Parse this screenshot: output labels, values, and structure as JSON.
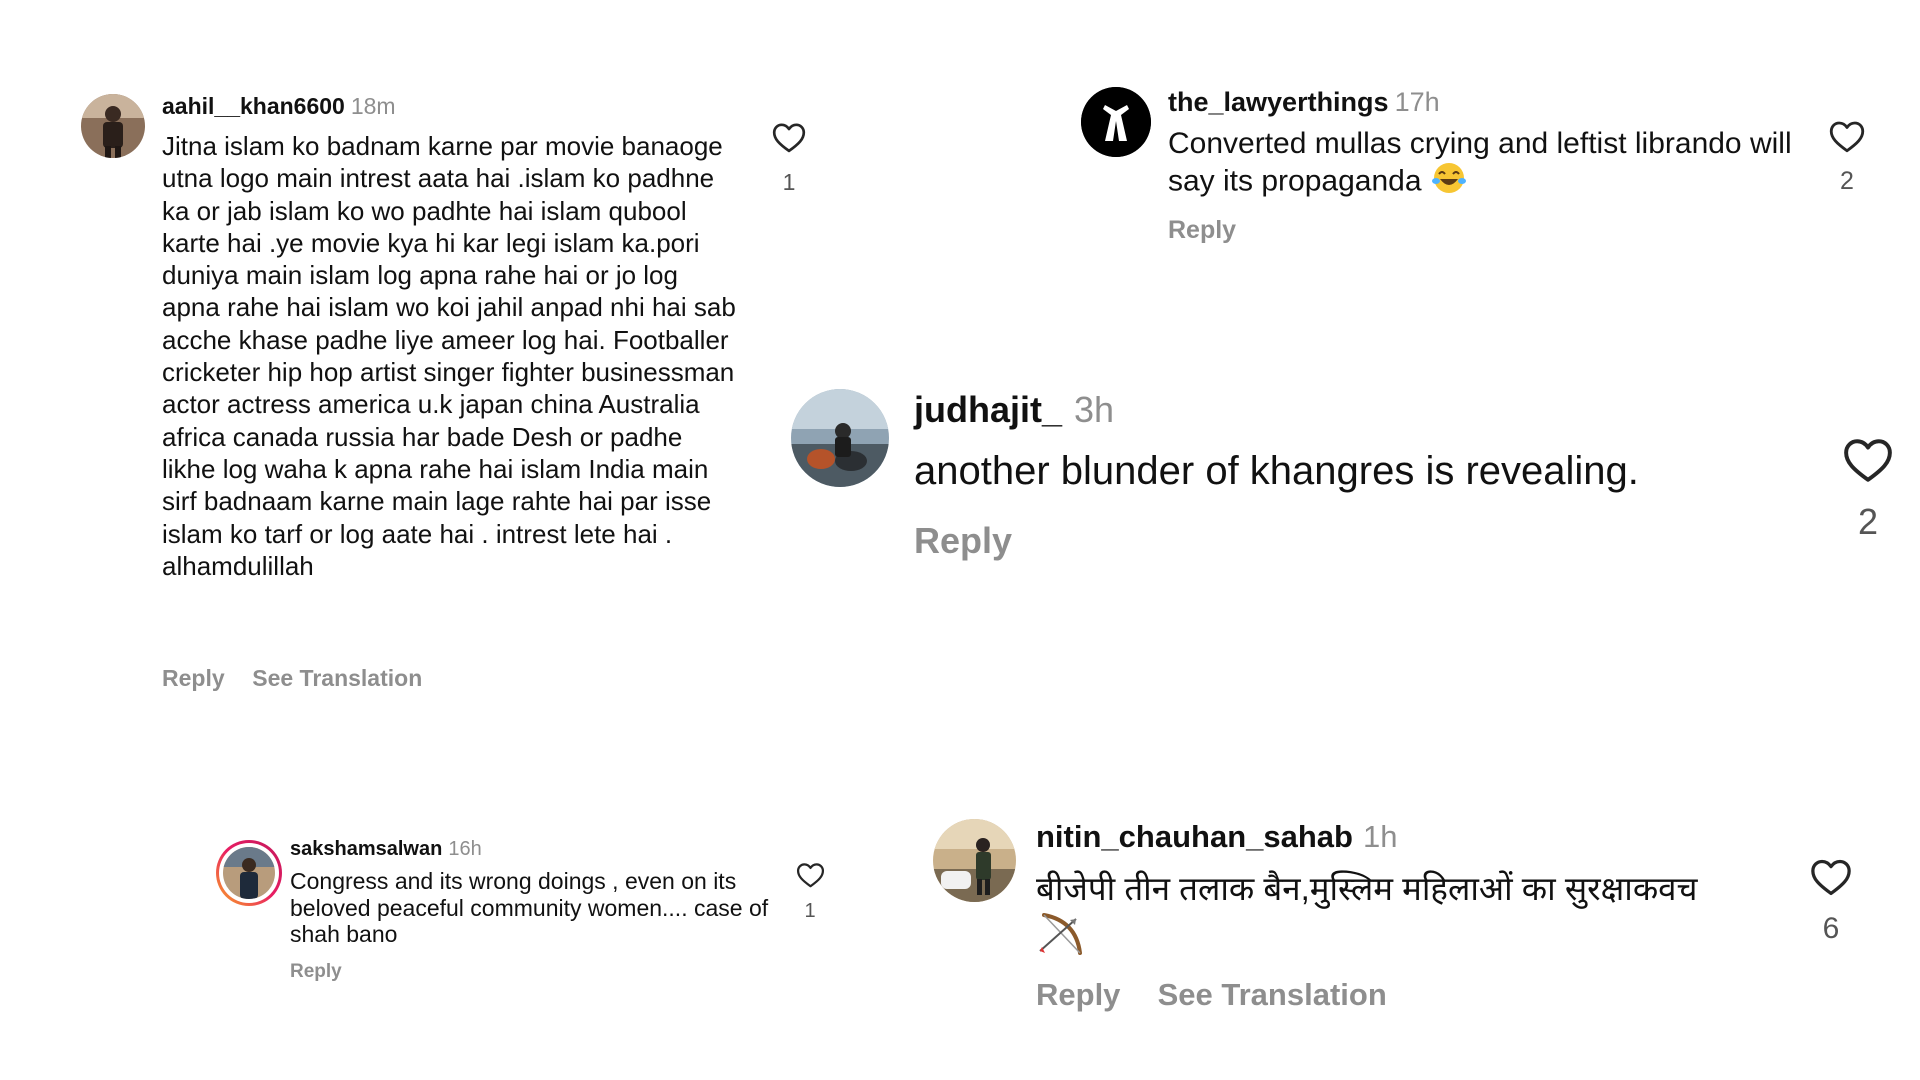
{
  "comments": [
    {
      "username": "aahil__khan6600",
      "time": "18m",
      "text": "Jitna islam ko badnam karne par movie banaoge utna logo main intrest aata hai .islam ko padhne ka or jab islam ko wo padhte hai islam qubool karte hai .ye movie kya hi kar legi islam ka.pori duniya main islam log apna rahe hai or jo log apna rahe hai islam wo koi jahil anpad nhi hai sab acche khase padhe liye ameer log hai. Footballer cricketer hip hop artist singer fighter businessman actor actress america u.k japan china Australia africa canada russia har bade Desh or padhe likhe log waha k apna rahe hai islam India main sirf badnaam karne main lage rahte hai par isse islam ko tarf or log aate hai . intrest lete hai . alhamdulillah",
      "reply_label": "Reply",
      "translation_label": "See Translation",
      "likes": "1"
    },
    {
      "username": "the_lawyerthings",
      "time": "17h",
      "text": "Converted mullas crying and leftist librando will say its propaganda",
      "emoji": "😂",
      "reply_label": "Reply",
      "likes": "2"
    },
    {
      "username": "judhajit_",
      "time": "3h",
      "text": "another blunder of khangres is revealing.",
      "reply_label": "Reply",
      "likes": "2"
    },
    {
      "username": "sakshamsalwan",
      "time": "16h",
      "text": "Congress and its wrong doings , even on its beloved peaceful community women.... case of shah bano",
      "reply_label": "Reply",
      "likes": "1"
    },
    {
      "username": "nitin_chauhan_sahab",
      "time": "1h",
      "text": "बीजेपी तीन तलाक बैन,मुस्लिम महिलाओं का सुरक्षाकवच",
      "emoji": "🏹",
      "reply_label": "Reply",
      "translation_label": "See Translation",
      "likes": "6"
    }
  ],
  "icons": {
    "like": "heart-outline-icon",
    "avatar_lawyer": "gavel-logo-icon"
  },
  "colors": {
    "text": "#111111",
    "muted": "#8e8e8e",
    "story_ring_start": "#f9a825",
    "story_ring_end": "#c2185b"
  }
}
